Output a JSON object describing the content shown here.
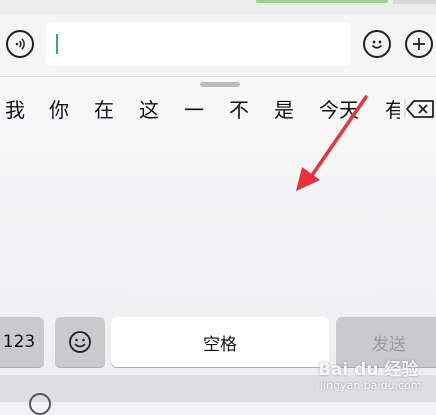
{
  "candidates": [
    "我",
    "你",
    "在",
    "这",
    "一",
    "不",
    "是",
    "今天",
    "有"
  ],
  "keyboard": {
    "numeric_label": "123",
    "space_label": "空格",
    "send_label": "发送"
  },
  "watermark": {
    "brand": "Bai du 经验",
    "url": "jingyan.baidu.com"
  },
  "icons": {
    "voice": "voice-icon",
    "emoji": "emoji-icon",
    "add": "plus-icon",
    "delete": "backspace-icon",
    "arrow": "red-arrow-annotation",
    "globe": "globe-icon"
  },
  "colors": {
    "caret": "#2bb673",
    "arrow": "#e8323c"
  }
}
